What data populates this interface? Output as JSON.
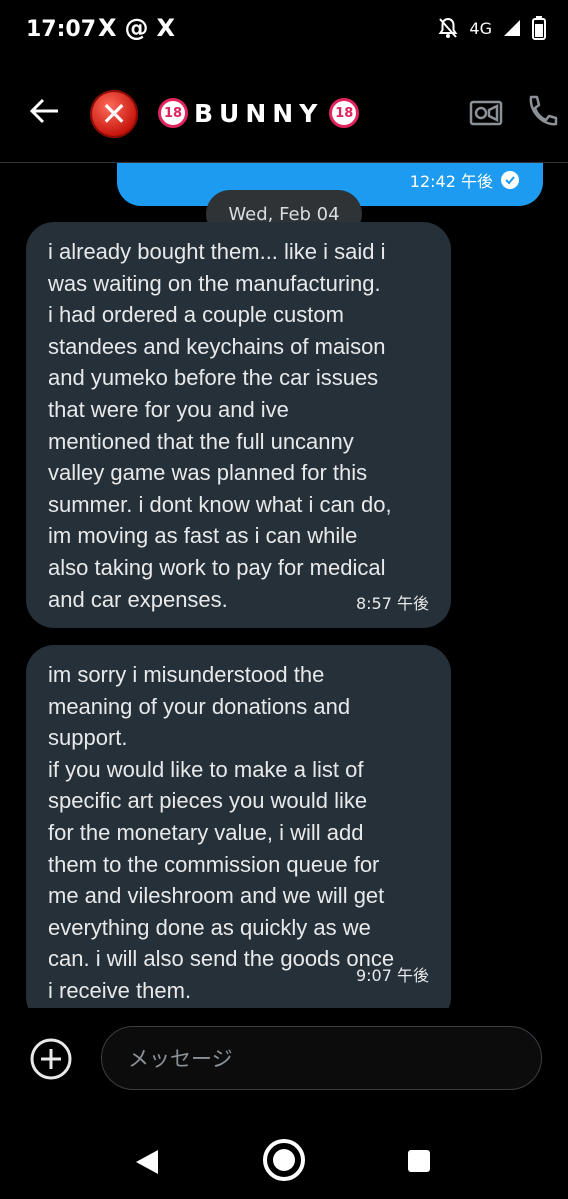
{
  "status_bar": {
    "time": "17:07",
    "app_icons": [
      "X",
      "@",
      "X"
    ],
    "network": "4G",
    "icons": [
      "x-logo-icon",
      "threads-icon",
      "x-logo-icon",
      "notifications-off-icon",
      "signal-icon",
      "battery-icon"
    ]
  },
  "header": {
    "contact_name": "BUNNY",
    "badge_left": "18",
    "badge_right": "18",
    "avatar_symbol": "✕",
    "icons": [
      "back-arrow-icon",
      "video-camera-icon",
      "phone-icon"
    ]
  },
  "conversation": {
    "sent_message": {
      "time": "12:42 午後",
      "read": true
    },
    "date_divider": "Wed, Feb 04",
    "received_messages": [
      {
        "text": "i already bought them... like i said i\nwas waiting on the manufacturing.\ni had ordered a couple custom\nstandees and keychains of maison\nand yumeko before the car issues\nthat were for you and ive\nmentioned that the full uncanny\nvalley game was planned for this\nsummer. i dont know what i can do,\nim moving as fast as i can while\nalso taking work to pay for medical\nand car expenses.",
        "time": "8:57 午後"
      },
      {
        "text": "im sorry i misunderstood the\nmeaning of your donations and\nsupport.\nif you would like to make a list of\nspecific art pieces you would like\nfor the monetary value, i will add\nthem to the commission queue for\nme and vileshroom and we will get\neverything done as quickly as we\ncan. i will also send the goods once\ni receive them.",
        "time": "9:07 午後"
      }
    ]
  },
  "composer": {
    "placeholder": "メッセージ"
  },
  "colors": {
    "sent_bubble": "#1d9bf0",
    "received_bubble": "#263038",
    "background": "#000000"
  }
}
